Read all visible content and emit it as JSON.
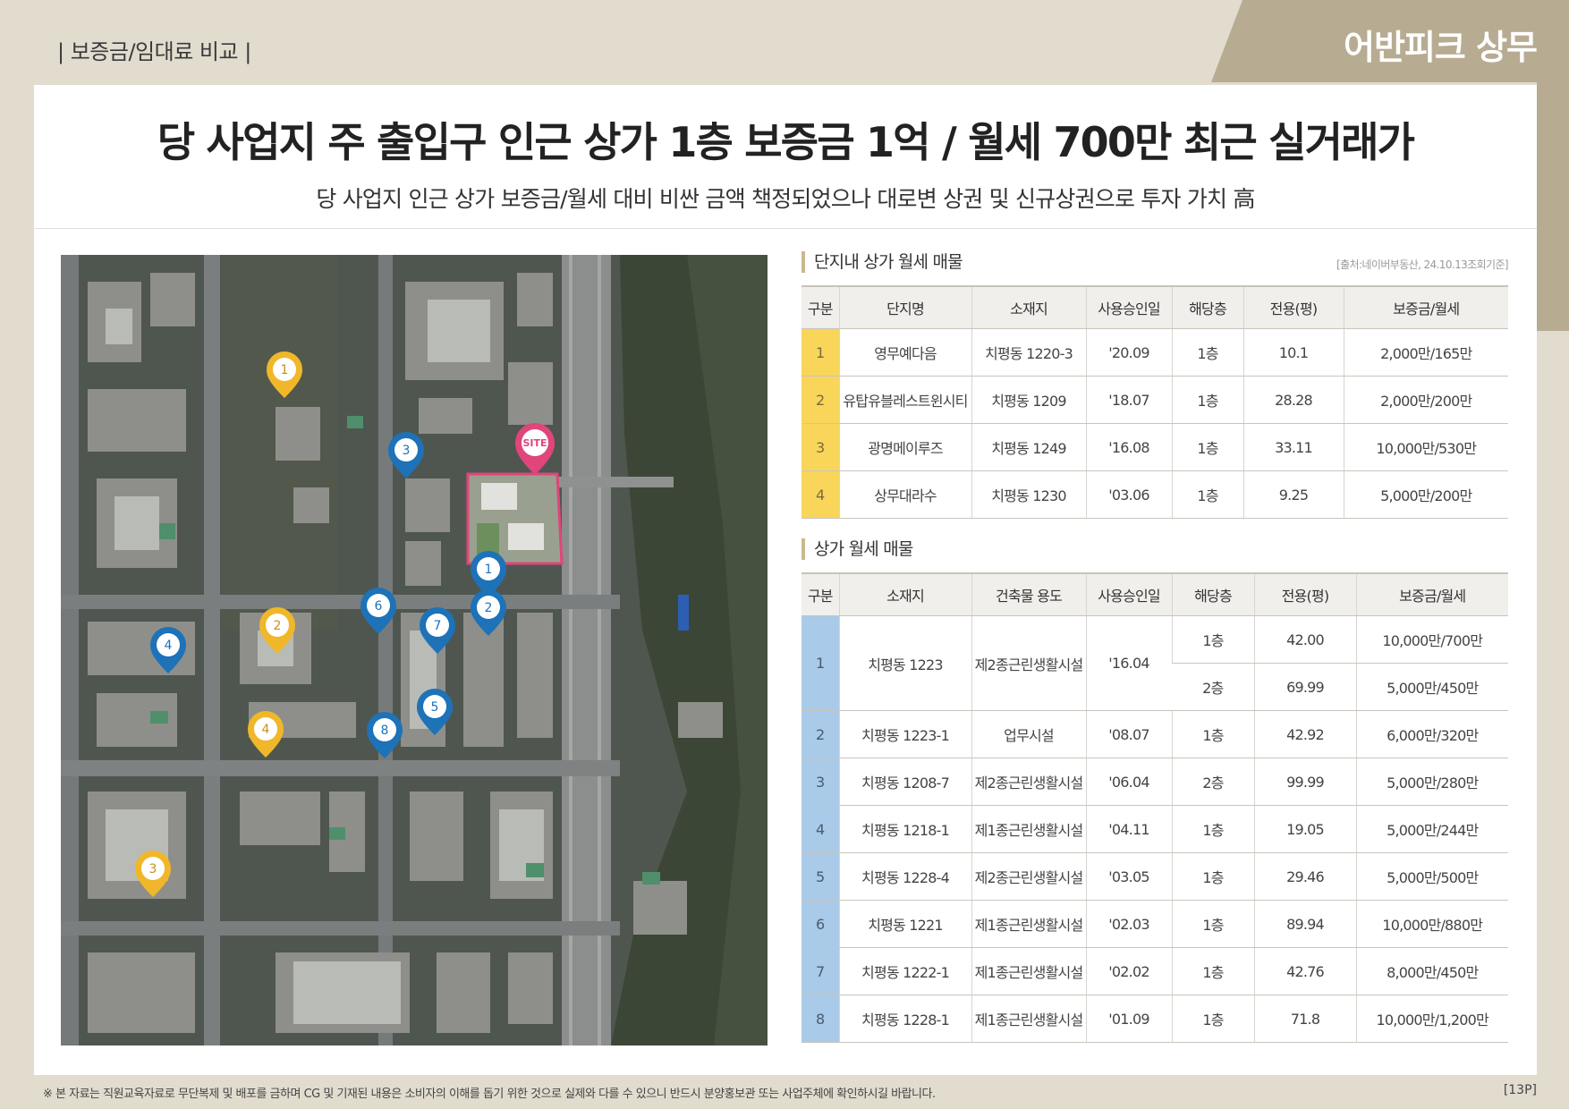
{
  "header": {
    "section_tag": "| 보증금/임대료 비교 |",
    "brand": "어반피크 상무"
  },
  "headline": {
    "title": "당 사업지 주 출입구 인근 상가 1층 보증금 1억 / 월세 700만 최근 실거래가",
    "subtitle": "당 사업지 인근 상가 보증금/월세 대비 비싼 금액 책정되었으나 대로변 상권 및 신규상권으로 투자 가치 高"
  },
  "map": {
    "site_label": "SITE",
    "complex_markers": [
      "1",
      "2",
      "3",
      "4"
    ],
    "shop_markers": [
      "1",
      "2",
      "3",
      "4",
      "5",
      "6",
      "7",
      "8"
    ],
    "colors": {
      "complex": "#f0b72a",
      "shop": "#1e72b8",
      "site": "#e0457b"
    }
  },
  "table1": {
    "title": "단지내 상가 월세 매물",
    "source": "[출처:네이버부동산, 24.10.13조회기준]",
    "headers": [
      "구분",
      "단지명",
      "소재지",
      "사용승인일",
      "해당층",
      "전용(평)",
      "보증금/월세"
    ],
    "rows": [
      [
        "1",
        "영무예다음",
        "치평동 1220-3",
        "'20.09",
        "1층",
        "10.1",
        "2,000만/165만"
      ],
      [
        "2",
        "유탑유블레스트윈시티",
        "치평동 1209",
        "'18.07",
        "1층",
        "28.28",
        "2,000만/200만"
      ],
      [
        "3",
        "광명메이루즈",
        "치평동 1249",
        "'16.08",
        "1층",
        "33.11",
        "10,000만/530만"
      ],
      [
        "4",
        "상무대라수",
        "치평동 1230",
        "'03.06",
        "1층",
        "9.25",
        "5,000만/200만"
      ]
    ]
  },
  "table2": {
    "title": "상가 월세 매물",
    "headers": [
      "구분",
      "소재지",
      "건축물 용도",
      "사용승인일",
      "해당층",
      "전용(평)",
      "보증금/월세"
    ],
    "row1": {
      "no": "1",
      "addr": "치평동 1223",
      "use": "제2종근린생활시설",
      "date": "'16.04",
      "floor_a": "1층",
      "area_a": "42.00",
      "price_a": "10,000만/700만",
      "floor_b": "2층",
      "area_b": "69.99",
      "price_b": "5,000만/450만"
    },
    "rows": [
      [
        "2",
        "치평동 1223-1",
        "업무시설",
        "'08.07",
        "1층",
        "42.92",
        "6,000만/320만"
      ],
      [
        "3",
        "치평동 1208-7",
        "제2종근린생활시설",
        "'06.04",
        "2층",
        "99.99",
        "5,000만/280만"
      ],
      [
        "4",
        "치평동 1218-1",
        "제1종근린생활시설",
        "'04.11",
        "1층",
        "19.05",
        "5,000만/244만"
      ],
      [
        "5",
        "치평동 1228-4",
        "제2종근린생활시설",
        "'03.05",
        "1층",
        "29.46",
        "5,000만/500만"
      ],
      [
        "6",
        "치평동 1221",
        "제1종근린생활시설",
        "'02.03",
        "1층",
        "89.94",
        "10,000만/880만"
      ],
      [
        "7",
        "치평동 1222-1",
        "제1종근린생활시설",
        "'02.02",
        "1층",
        "42.76",
        "8,000만/450만"
      ],
      [
        "8",
        "치평동 1228-1",
        "제1종근린생활시설",
        "'01.09",
        "1층",
        "71.8",
        "10,000만/1,200만"
      ]
    ]
  },
  "footer": {
    "note": "※ 본 자료는 직원교육자료로 무단복제 및 배포를 금하며 CG 및 기재된 내용은 소비자의 이해를 돕기 위한 것으로 실제와 다를 수 있으니 반드시 분양홍보관 또는 사업주체에 확인하시길 바랍니다.",
    "page": "[13P]"
  }
}
